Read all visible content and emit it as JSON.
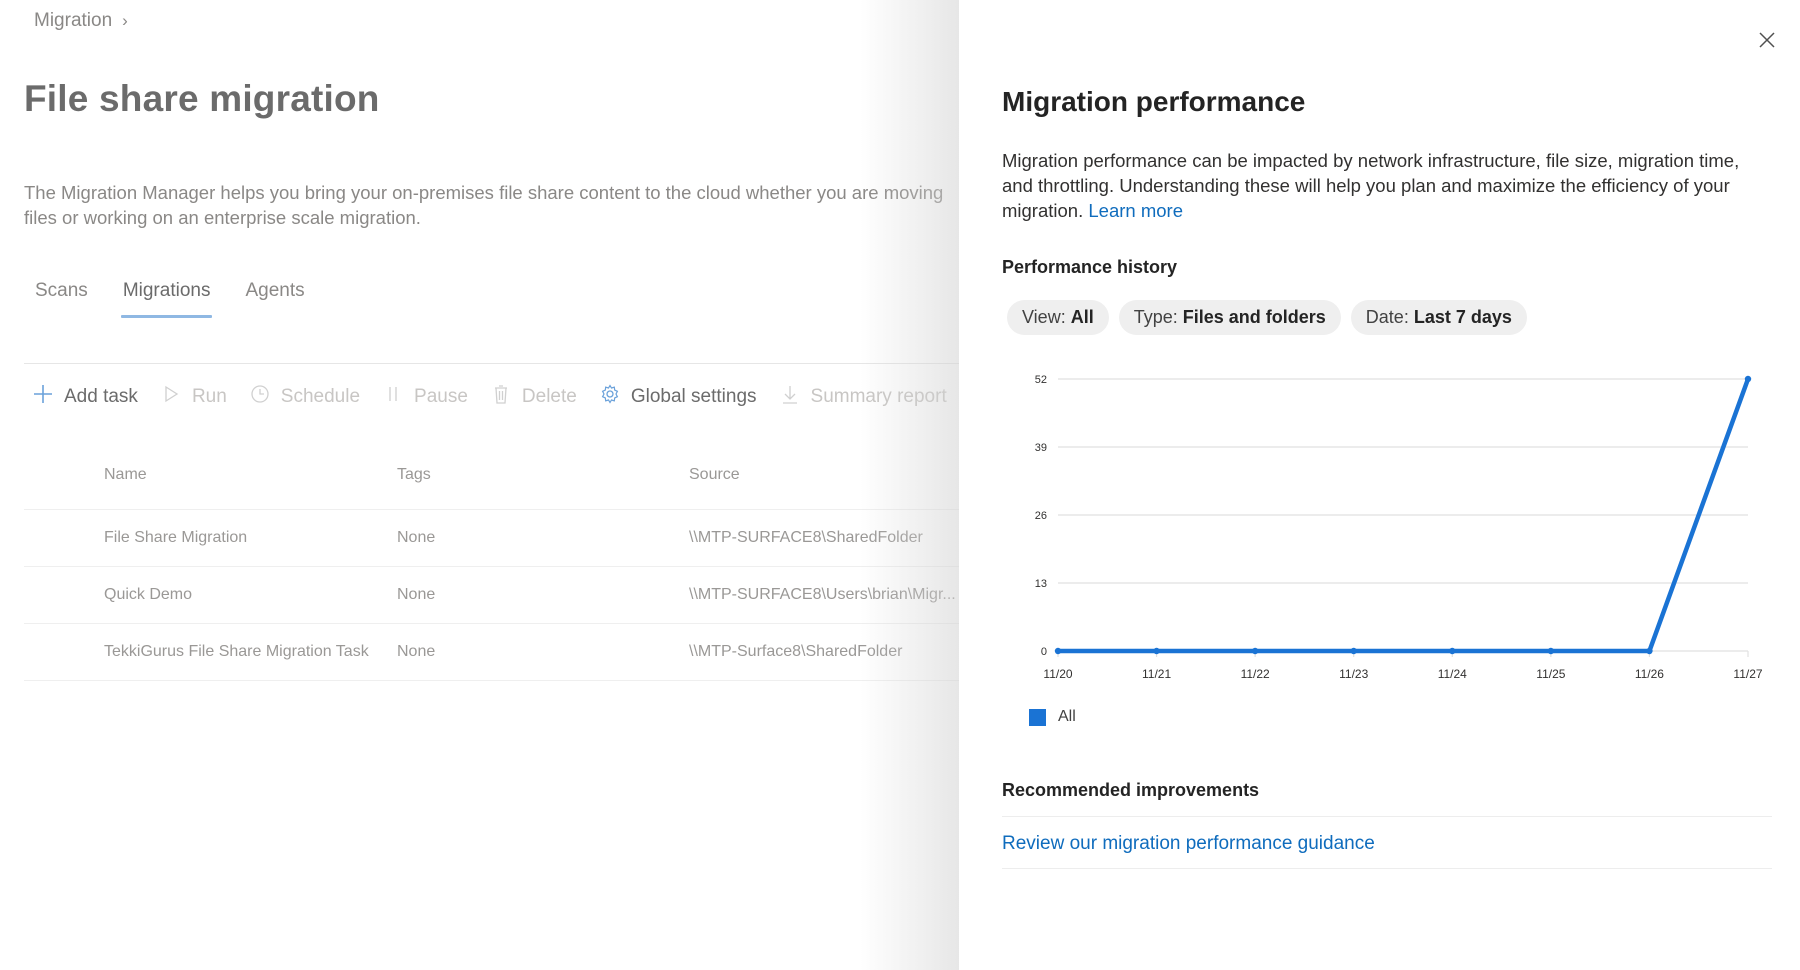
{
  "breadcrumb": {
    "items": [
      "Migration"
    ],
    "separator_icon": "chevron-right-icon"
  },
  "page": {
    "title": "File share migration",
    "description_line1": "The Migration Manager helps you bring your on-premises file share content to the cloud whether you are moving",
    "description_line2": "files or working on an enterprise scale migration."
  },
  "tabs": [
    {
      "label": "Scans",
      "active": false
    },
    {
      "label": "Migrations",
      "active": true
    },
    {
      "label": "Agents",
      "active": false
    }
  ],
  "toolbar": [
    {
      "label": "Add task",
      "icon": "plus-icon",
      "enabled": true
    },
    {
      "label": "Run",
      "icon": "play-icon",
      "enabled": false
    },
    {
      "label": "Schedule",
      "icon": "clock-icon",
      "enabled": false
    },
    {
      "label": "Pause",
      "icon": "pause-icon",
      "enabled": false
    },
    {
      "label": "Delete",
      "icon": "trash-icon",
      "enabled": false
    },
    {
      "label": "Global settings",
      "icon": "gear-icon",
      "enabled": true
    },
    {
      "label": "Summary report",
      "icon": "download-icon",
      "enabled": false
    },
    {
      "label": "",
      "icon": "tag-icon",
      "enabled": true
    }
  ],
  "table": {
    "columns": [
      "Name",
      "Tags",
      "Source"
    ],
    "rows": [
      {
        "name": "File Share Migration",
        "tags": "None",
        "source": "\\\\MTP-SURFACE8\\SharedFolder"
      },
      {
        "name": "Quick Demo",
        "tags": "None",
        "source": "\\\\MTP-SURFACE8\\Users\\brian\\Migr..."
      },
      {
        "name": "TekkiGurus File Share Migration Task",
        "tags": "None",
        "source": "\\\\MTP-Surface8\\SharedFolder"
      }
    ]
  },
  "panel": {
    "title": "Migration performance",
    "description": "Migration performance can be impacted by network infrastructure, file size, migration time, and throttling. Understanding these will help you plan and maximize the efficiency of your migration.",
    "learn_more": "Learn more",
    "history_title": "Performance history",
    "filters": [
      {
        "key": "View:",
        "value": "All"
      },
      {
        "key": "Type:",
        "value": "Files and folders"
      },
      {
        "key": "Date:",
        "value": "Last 7 days"
      }
    ],
    "recommended_title": "Recommended improvements",
    "recommended_link": "Review our migration performance guidance",
    "close_icon": "close-icon"
  },
  "colors": {
    "accent": "#0f6cbd",
    "series": "#1a73d4",
    "grid": "#e1e1e1"
  },
  "chart_data": {
    "type": "line",
    "title": "Performance history",
    "xlabel": "",
    "ylabel": "",
    "x": [
      "11/20",
      "11/21",
      "11/22",
      "11/23",
      "11/24",
      "11/25",
      "11/26",
      "11/27"
    ],
    "series": [
      {
        "name": "All",
        "values": [
          0,
          0,
          0,
          0,
          0,
          0,
          0,
          52
        ]
      }
    ],
    "yticks": [
      0,
      13,
      26,
      39,
      52
    ],
    "ylim": [
      0,
      52
    ],
    "grid": true,
    "legend": "bottom-left"
  }
}
